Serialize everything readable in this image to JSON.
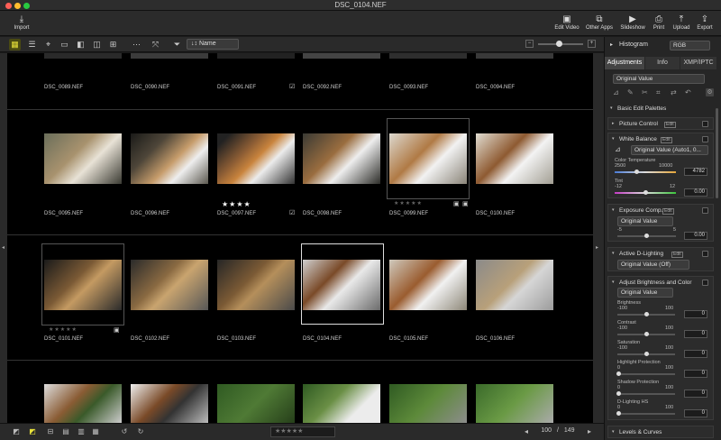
{
  "window": {
    "title": "DSC_0104.NEF"
  },
  "toolbar": {
    "import": "Import",
    "edit_video": "Edit Video",
    "other_apps": "Other Apps",
    "slideshow": "Slideshow",
    "print": "Print",
    "upload": "Upload",
    "export": "Export"
  },
  "subbar": {
    "sort_label": "↓↕ Name"
  },
  "rows": [
    {
      "files": [
        "DSC_0089.NEF",
        "DSC_0090.NEF",
        "DSC_0091.NEF",
        "DSC_0092.NEF",
        "DSC_0093.NEF",
        "DSC_0094.NEF"
      ]
    },
    {
      "files": [
        "DSC_0095.NEF",
        "DSC_0096.NEF",
        "DSC_0097.NEF",
        "DSC_0098.NEF",
        "DSC_0099.NEF",
        "DSC_0100.NEF"
      ]
    },
    {
      "files": [
        "DSC_0101.NEF",
        "DSC_0102.NEF",
        "DSC_0103.NEF",
        "DSC_0104.NEF",
        "DSC_0105.NEF",
        "DSC_0106.NEF"
      ]
    }
  ],
  "ratings": {
    "stars_4": "★★★★",
    "empty_5": "★★★★★"
  },
  "bottombar": {
    "page_current": "100",
    "page_sep": "/",
    "page_total": "149"
  },
  "panel": {
    "histogram": "Histogram",
    "histogram_mode": "RGB",
    "tabs": [
      "Adjustments",
      "Info",
      "XMP/IPTC"
    ],
    "preset": "Original Value",
    "basic_palettes": "Basic Edit Palettes",
    "picture_control": "Picture Control",
    "white_balance": "White Balance",
    "wb_value": "Original Value (Auto1, 0...",
    "color_temp_label": "Color Temperature",
    "color_temp_min": "2500",
    "color_temp_max": "10000",
    "color_temp_val": "4782",
    "tint_label": "Tint",
    "tint_min": "-12",
    "tint_max": "12",
    "tint_val": "0.00",
    "exposure_comp": "Exposure Comp.",
    "exposure_preset": "Original Value",
    "exposure_min": "-5",
    "exposure_max": "5",
    "exposure_val": "0.00",
    "active_dlighting": "Active D-Lighting",
    "adl_value": "Original Value (Off)",
    "adjust_bc": "Adjust Brightness and Color",
    "abc_preset": "Original Value",
    "brightness": "Brightness",
    "contrast": "Contrast",
    "saturation": "Saturation",
    "highlight": "Highlight Protection",
    "shadow": "Shadow Protection",
    "dlighting_hs": "D-Lighting HS",
    "range_min": "-100",
    "range_min0": "0",
    "range_max": "100",
    "zero": "0",
    "levels_curves": "Levels & Curves",
    "edit_badge": "Edit"
  },
  "colors": {
    "accent": "#e8e23a",
    "panel_bg": "#262626",
    "grid_bg": "#000000"
  }
}
